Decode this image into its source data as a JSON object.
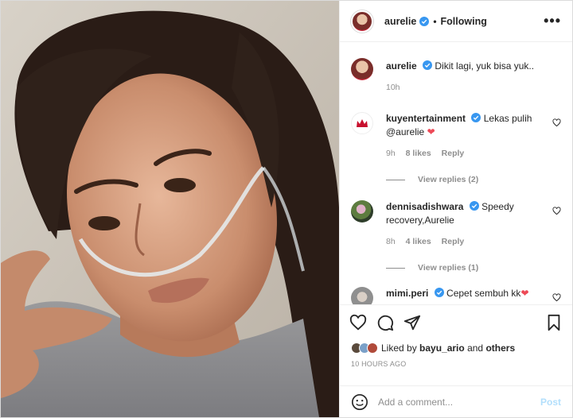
{
  "header": {
    "username": "aurelie",
    "separator": "•",
    "follow_state": "Following",
    "more_label": "•••"
  },
  "caption": {
    "username": "aurelie",
    "text": "Dikit lagi, yuk bisa yuk..",
    "time": "10h"
  },
  "comments": [
    {
      "username": "kuyentertainment",
      "text": "Lekas pulih @aurelie",
      "emoji": "❤",
      "time": "9h",
      "likes": "8 likes",
      "reply_label": "Reply",
      "view_replies": "View replies (2)",
      "avatar_color": "#c8102e"
    },
    {
      "username": "dennisadishwara",
      "text": "Speedy recovery,Aurelie",
      "time": "8h",
      "likes": "4 likes",
      "reply_label": "Reply",
      "view_replies": "View replies (1)",
      "avatar_color": "#4a6e3a"
    },
    {
      "username": "mimi.peri",
      "text": "Cepet sembuh kk",
      "emoji": "❤",
      "avatar_color": "#9a9a9a"
    }
  ],
  "likes": {
    "prefix": "Liked by ",
    "user": "bayu_ario",
    "suffix": " and ",
    "others": "others"
  },
  "timestamp": "10 HOURS AGO",
  "add_comment": {
    "placeholder": "Add a comment...",
    "post_label": "Post"
  },
  "colors": {
    "verified": "#3897f0",
    "heart_red": "#ed4956",
    "post_disabled": "#b2dffc"
  },
  "icons": [
    "heart-icon",
    "comment-icon",
    "share-icon",
    "bookmark-icon",
    "emoji-icon",
    "verified-badge-icon",
    "more-icon"
  ]
}
